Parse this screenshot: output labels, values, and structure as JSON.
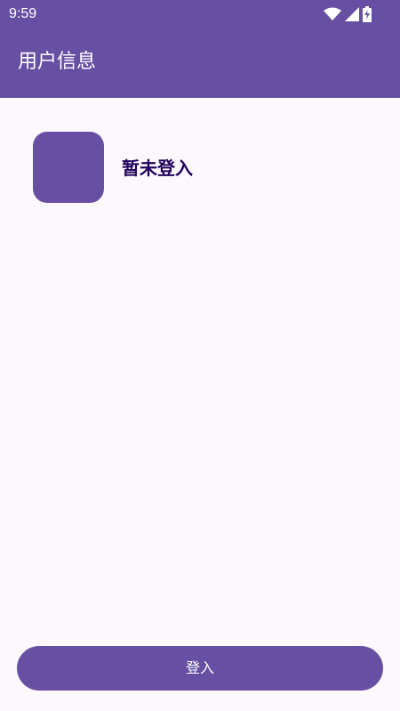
{
  "status_bar": {
    "time": "9:59",
    "icons": [
      "wifi-icon",
      "signal-icon",
      "battery-charging-icon"
    ]
  },
  "app_bar": {
    "title": "用户信息"
  },
  "profile": {
    "status_text": "暂未登入"
  },
  "actions": {
    "login_label": "登入"
  },
  "colors": {
    "primary": "#6750a4",
    "background": "#fdf8fd",
    "status_text": "#21005d",
    "on_primary": "#ffffff"
  }
}
